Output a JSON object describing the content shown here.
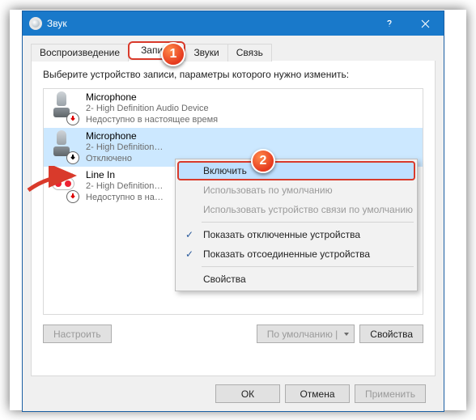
{
  "window": {
    "title": "Звук",
    "close_tooltip": "Закрыть"
  },
  "tabs": {
    "playback": "Воспроизведение",
    "recording": "Запись",
    "sounds": "Звуки",
    "communications": "Связь"
  },
  "instruction": "Выберите устройство записи, параметры которого нужно изменить:",
  "devices": [
    {
      "name": "Microphone",
      "subtitle": "2- High Definition Audio Device",
      "status": "Недоступно в настоящее время"
    },
    {
      "name": "Microphone",
      "subtitle": "2- High Definition…",
      "status": "Отключено"
    },
    {
      "name": "Line In",
      "subtitle": "2- High Definition…",
      "status": "Недоступно в на…"
    }
  ],
  "buttons": {
    "configure": "Настроить",
    "default": "По умолчанию",
    "properties": "Свойства",
    "ok": "ОК",
    "cancel": "Отмена",
    "apply": "Применить"
  },
  "context_menu": {
    "enable": "Включить",
    "use_default": "Использовать по умолчанию",
    "use_default_comm": "Использовать устройство связи по умолчанию",
    "show_disabled": "Показать отключенные устройства",
    "show_disconnected": "Показать отсоединенные устройства",
    "properties": "Свойства"
  },
  "annotations": {
    "marker1": "1",
    "marker2": "2"
  }
}
